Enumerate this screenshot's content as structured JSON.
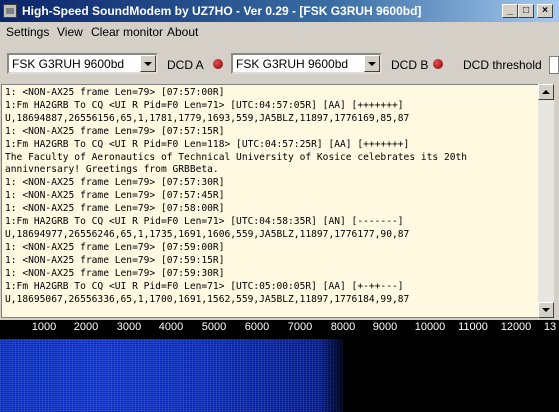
{
  "window": {
    "title": "High-Speed SoundModem by UZ7HO - Ver 0.29 - [FSK G3RUH 9600bd]"
  },
  "window_buttons": {
    "minimize": "_",
    "maximize": "□",
    "close": "×"
  },
  "menu": {
    "settings": "Settings",
    "view": "View",
    "clear_monitor": "Clear monitor",
    "about": "About"
  },
  "toolbar": {
    "modem_a": "FSK G3RUH 9600bd",
    "dcd_a_label": "DCD A",
    "modem_b": "FSK G3RUH 9600bd",
    "dcd_b_label": "DCD B",
    "dcd_threshold_label": "DCD threshold"
  },
  "monitor": {
    "text": "1: <NON-AX25 frame Len=79> [07:57:00R]\n1:Fm HA2GRB To CQ <UI R Pid=F0 Len=71> [UTC:04:57:05R] [AA] [+++++++]\nU,18694887,26556156,65,1,1781,1779,1693,559,JA5BLZ,11897,1776169,85,87\n1: <NON-AX25 frame Len=79> [07:57:15R]\n1:Fm HA2GRB To CQ <UI R Pid=F0 Len=118> [UTC:04:57:25R] [AA] [+++++++]\nThe Faculty of Aeronautics of Technical University of Kosice celebrates its 20th\nannivnersary! Greetings from GRBBeta.\n1: <NON-AX25 frame Len=79> [07:57:30R]\n1: <NON-AX25 frame Len=79> [07:57:45R]\n1: <NON-AX25 frame Len=79> [07:58:00R]\n1:Fm HA2GRB To CQ <UI R Pid=F0 Len=71> [UTC:04:58:35R] [AN] [-------]\nU,18694977,26556246,65,1,1735,1691,1606,559,JA5BLZ,11897,1776177,90,87\n1: <NON-AX25 frame Len=79> [07:59:00R]\n1: <NON-AX25 frame Len=79> [07:59:15R]\n1: <NON-AX25 frame Len=79> [07:59:30R]\n1:Fm HA2GRB To CQ <UI R Pid=F0 Len=71> [UTC:05:00:05R] [AA] [+-++---]\nU,18695067,26556336,65,1,1700,1691,1562,559,JA5BLZ,11897,1776184,99,87"
  },
  "waterfall": {
    "ticks": [
      "1000",
      "2000",
      "3000",
      "4000",
      "5000",
      "6000",
      "7000",
      "8000",
      "9000",
      "10000",
      "11000",
      "12000",
      "13"
    ]
  },
  "colors": {
    "title_start": "#0a246a",
    "monitor_bg": "#fff9e1",
    "waterfall_signal": "#2244d4",
    "led": "#b00000"
  }
}
